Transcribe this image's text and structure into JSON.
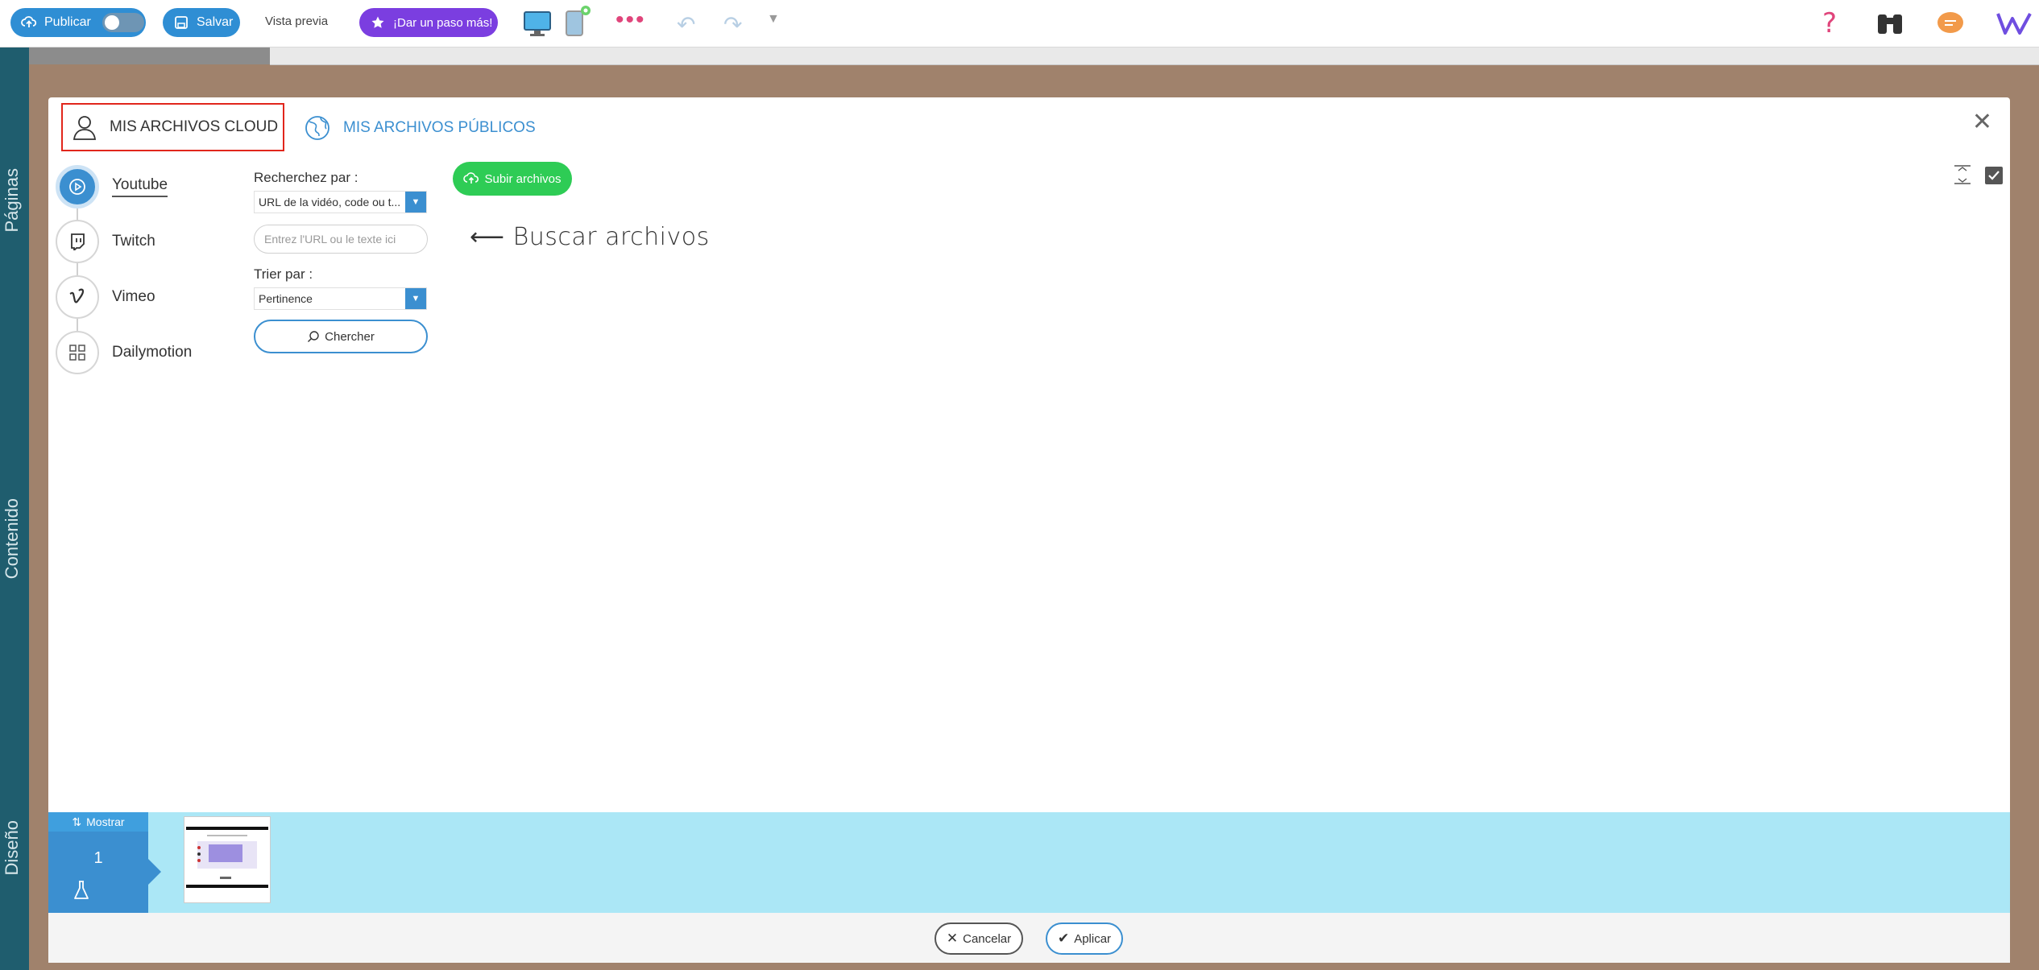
{
  "toolbar": {
    "publish_label": "Publicar",
    "save_label": "Salvar",
    "preview_label": "Vista previa",
    "upgrade_label": "¡Dar un paso más!",
    "more_dots": "•••"
  },
  "left_rail": {
    "pages_label": "Páginas",
    "content_label": "Contenido",
    "design_label": "Diseño"
  },
  "modal": {
    "tabs": [
      {
        "label": "MIS ARCHIVOS CLOUD",
        "icon": "user-icon",
        "active": true
      },
      {
        "label": "MIS ARCHIVOS PÚBLICOS",
        "icon": "globe-icon",
        "active": false
      }
    ],
    "providers": [
      {
        "label": "Youtube",
        "icon": "play-icon",
        "active": true
      },
      {
        "label": "Twitch",
        "icon": "twitch-icon",
        "active": false
      },
      {
        "label": "Vimeo",
        "icon": "vimeo-icon",
        "active": false
      },
      {
        "label": "Dailymotion",
        "icon": "grid-icon",
        "active": false
      }
    ],
    "search": {
      "search_by_label": "Recherchez par :",
      "search_by_value": "URL de la vidéo, code ou t...",
      "url_placeholder": "Entrez l'URL ou le texte ici",
      "sort_by_label": "Trier par :",
      "sort_by_value": "Pertinence",
      "search_button": "Chercher"
    },
    "upload_button": "Subir archivos",
    "hint_text": "Buscar archivos",
    "strip": {
      "show_label": "Mostrar",
      "page_number": "1"
    },
    "footer": {
      "cancel_label": "Cancelar",
      "apply_label": "Aplicar"
    }
  },
  "colors": {
    "accent_blue": "#3b8fd0",
    "upgrade_purple": "#7b3ee0",
    "upload_green": "#2ecc55",
    "highlight_red": "#e1261c",
    "strip_cyan": "#abe7f6"
  }
}
